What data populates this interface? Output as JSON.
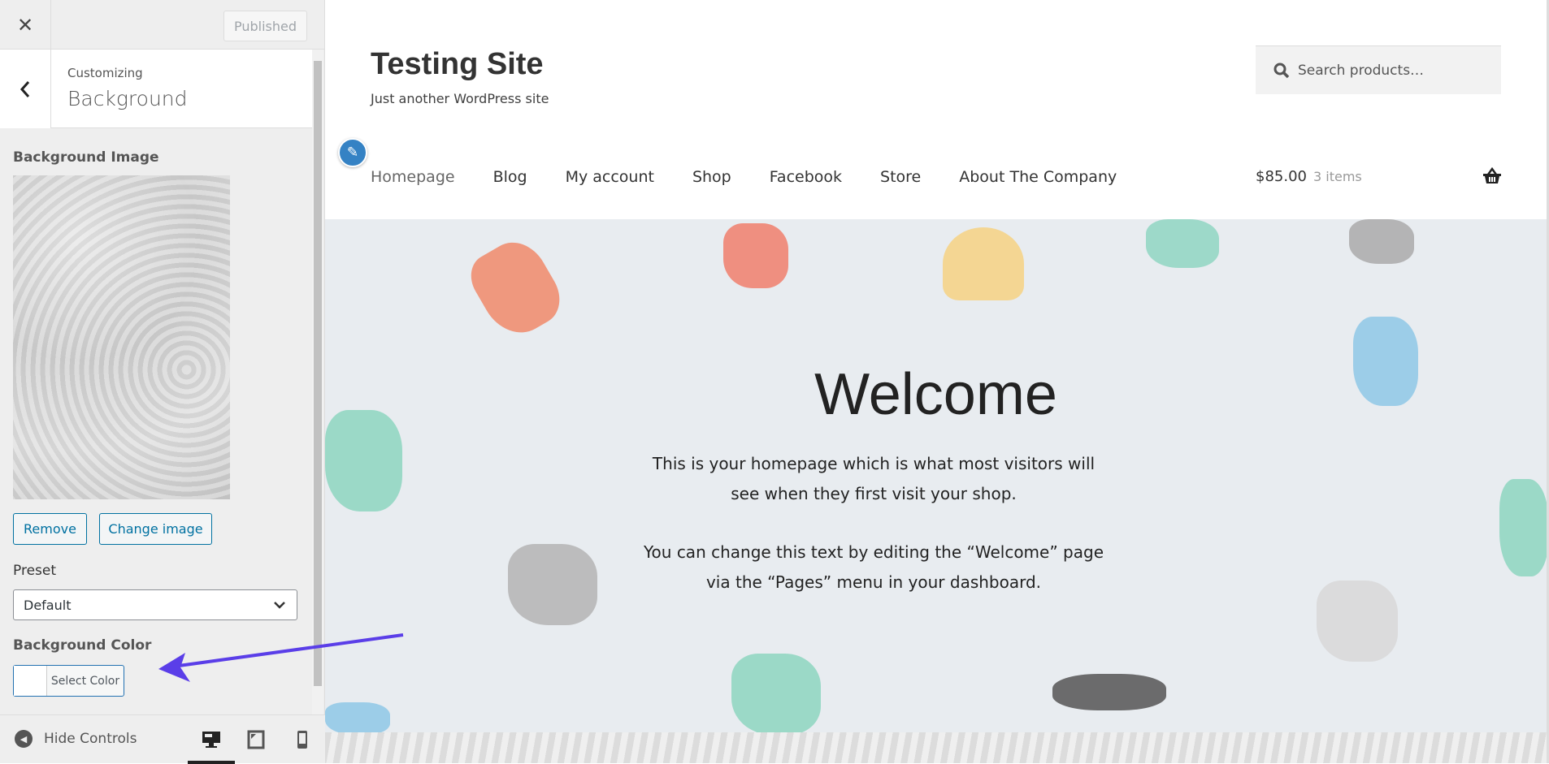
{
  "sidebar": {
    "close_icon": "close-icon",
    "published_label": "Published",
    "customizing_label": "Customizing",
    "section_title": "Background",
    "background_image_label": "Background Image",
    "remove_label": "Remove",
    "change_image_label": "Change image",
    "preset_label": "Preset",
    "preset_value": "Default",
    "background_color_label": "Background Color",
    "select_color_label": "Select Color",
    "hide_controls_label": "Hide Controls",
    "devices": [
      "desktop",
      "tablet",
      "mobile"
    ],
    "active_device": "desktop"
  },
  "preview": {
    "site_title": "Testing Site",
    "tagline": "Just another WordPress site",
    "search_placeholder": "Search products…",
    "nav": [
      "Homepage",
      "Blog",
      "My account",
      "Shop",
      "Facebook",
      "Store",
      "About The Company"
    ],
    "cart_total": "$85.00",
    "cart_items": "3 items",
    "welcome_title": "Welcome",
    "paragraph1": "This is your homepage which is what most visitors will see when they first visit your shop.",
    "paragraph2": "You can change this text by editing the “Welcome” page via the “Pages” menu in your dashboard."
  },
  "colors": {
    "accent": "#0071a1",
    "arrow": "#5a3ee8",
    "pencil": "#3582c4"
  }
}
